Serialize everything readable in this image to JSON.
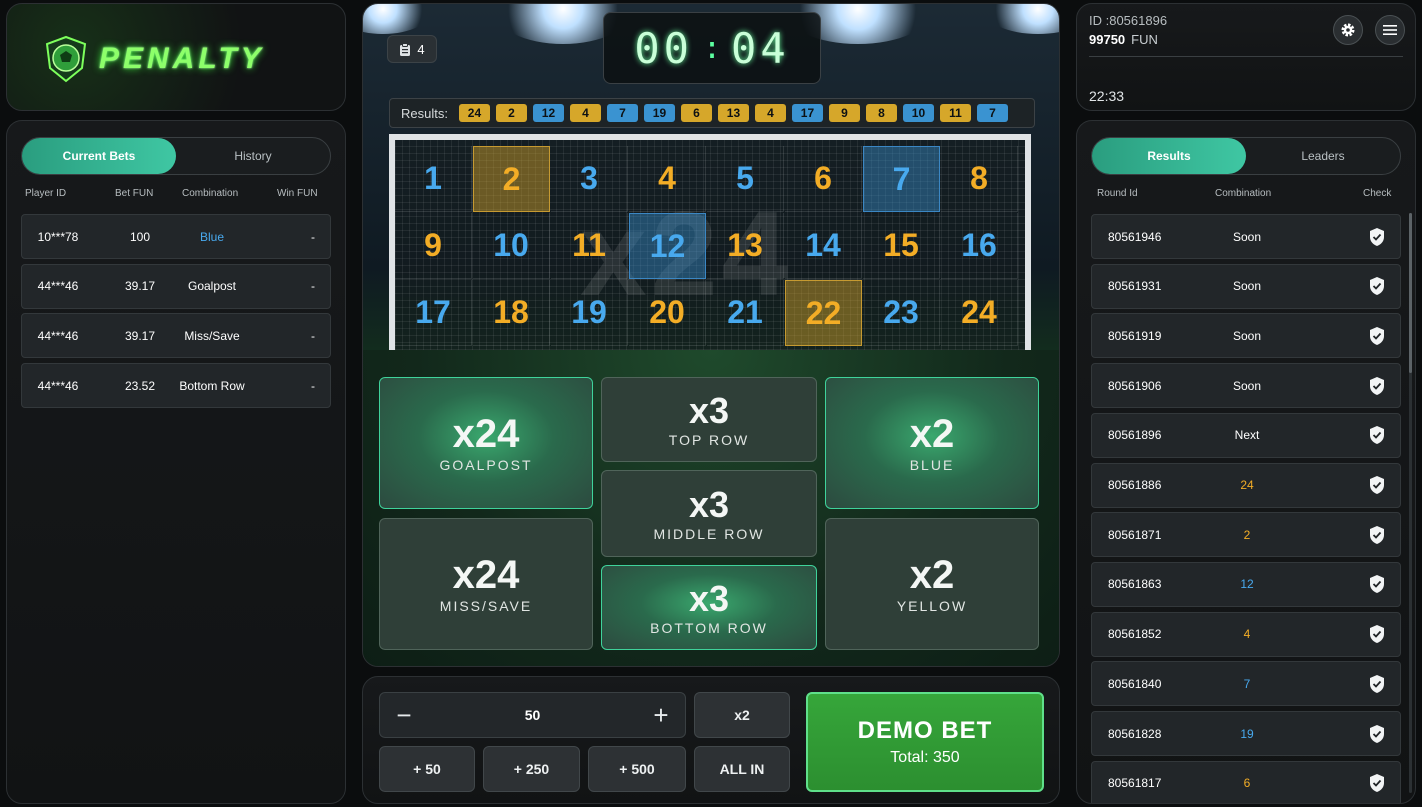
{
  "logo": {
    "text": "PENALTY"
  },
  "bets": {
    "tabs": [
      {
        "label": "Current Bets",
        "active": true
      },
      {
        "label": "History",
        "active": false
      }
    ],
    "headers": {
      "player": "Player ID",
      "bet": "Bet FUN",
      "combination": "Combination",
      "win": "Win FUN"
    },
    "rows": [
      {
        "player": "10***78",
        "bet": "100",
        "combination": "Blue",
        "win": "-",
        "comb_color": "#48a9ee"
      },
      {
        "player": "44***46",
        "bet": "39.17",
        "combination": "Goalpost",
        "win": "-",
        "comb_color": "#ffffff"
      },
      {
        "player": "44***46",
        "bet": "39.17",
        "combination": "Miss/Save",
        "win": "-",
        "comb_color": "#ffffff"
      },
      {
        "player": "44***46",
        "bet": "23.52",
        "combination": "Bottom Row",
        "win": "-",
        "comb_color": "#ffffff"
      }
    ]
  },
  "game": {
    "round_badge": "4",
    "round_badge_icon": "clipboard-icon",
    "timer": {
      "minutes": "00",
      "seconds": "04"
    },
    "results_label": "Results:",
    "results": [
      {
        "n": "24",
        "color": "yellow"
      },
      {
        "n": "2",
        "color": "yellow"
      },
      {
        "n": "12",
        "color": "blue"
      },
      {
        "n": "4",
        "color": "yellow"
      },
      {
        "n": "7",
        "color": "blue"
      },
      {
        "n": "19",
        "color": "blue"
      },
      {
        "n": "6",
        "color": "yellow"
      },
      {
        "n": "13",
        "color": "yellow"
      },
      {
        "n": "4",
        "color": "yellow"
      },
      {
        "n": "17",
        "color": "blue"
      },
      {
        "n": "9",
        "color": "yellow"
      },
      {
        "n": "8",
        "color": "yellow"
      },
      {
        "n": "10",
        "color": "blue"
      },
      {
        "n": "11",
        "color": "yellow"
      },
      {
        "n": "7",
        "color": "blue"
      }
    ],
    "goal_watermark": "x24",
    "grid": [
      {
        "n": "1",
        "c": "b"
      },
      {
        "n": "2",
        "c": "y",
        "hl": "y"
      },
      {
        "n": "3",
        "c": "b"
      },
      {
        "n": "4",
        "c": "y"
      },
      {
        "n": "5",
        "c": "b"
      },
      {
        "n": "6",
        "c": "y"
      },
      {
        "n": "7",
        "c": "b",
        "hl": "b"
      },
      {
        "n": "8",
        "c": "y"
      },
      {
        "n": "9",
        "c": "y"
      },
      {
        "n": "10",
        "c": "b"
      },
      {
        "n": "11",
        "c": "y"
      },
      {
        "n": "12",
        "c": "b",
        "hl": "b"
      },
      {
        "n": "13",
        "c": "y"
      },
      {
        "n": "14",
        "c": "b"
      },
      {
        "n": "15",
        "c": "y"
      },
      {
        "n": "16",
        "c": "b"
      },
      {
        "n": "17",
        "c": "b"
      },
      {
        "n": "18",
        "c": "y"
      },
      {
        "n": "19",
        "c": "b"
      },
      {
        "n": "20",
        "c": "y"
      },
      {
        "n": "21",
        "c": "b"
      },
      {
        "n": "22",
        "c": "y",
        "hl": "y"
      },
      {
        "n": "23",
        "c": "b"
      },
      {
        "n": "24",
        "c": "y"
      }
    ],
    "options": {
      "goalpost": {
        "mult": "x24",
        "name": "GOALPOST"
      },
      "top_row": {
        "mult": "x3",
        "name": "TOP ROW"
      },
      "blue": {
        "mult": "x2",
        "name": "BLUE"
      },
      "middle_row": {
        "mult": "x3",
        "name": "MIDDLE ROW"
      },
      "miss_save": {
        "mult": "x24",
        "name": "MISS/SAVE"
      },
      "bottom_row": {
        "mult": "x3",
        "name": "BOTTOM ROW"
      },
      "yellow": {
        "mult": "x2",
        "name": "YELLOW"
      }
    }
  },
  "controls": {
    "amount": "50",
    "minus": "−",
    "plus": "+",
    "double": "x2",
    "quick": [
      "+ 50",
      "+ 250",
      "+ 500"
    ],
    "all_in": "ALL IN",
    "demo_bet": "DEMO BET",
    "total": "Total: 350"
  },
  "account": {
    "id": "ID :80561896",
    "balance": "99750",
    "currency": "FUN",
    "time": "22:33"
  },
  "results_panel": {
    "tabs": [
      {
        "label": "Results",
        "active": true
      },
      {
        "label": "Leaders",
        "active": false
      }
    ],
    "headers": {
      "round": "Round Id",
      "combination": "Combination",
      "check": "Check"
    },
    "rows": [
      {
        "id": "80561946",
        "comb": "Soon",
        "color": "#ffffff"
      },
      {
        "id": "80561931",
        "comb": "Soon",
        "color": "#ffffff"
      },
      {
        "id": "80561919",
        "comb": "Soon",
        "color": "#ffffff"
      },
      {
        "id": "80561906",
        "comb": "Soon",
        "color": "#ffffff"
      },
      {
        "id": "80561896",
        "comb": "Next",
        "color": "#ffffff"
      },
      {
        "id": "80561886",
        "comb": "24",
        "color": "#f3ad26"
      },
      {
        "id": "80561871",
        "comb": "2",
        "color": "#f3ad26"
      },
      {
        "id": "80561863",
        "comb": "12",
        "color": "#48a9ee"
      },
      {
        "id": "80561852",
        "comb": "4",
        "color": "#f3ad26"
      },
      {
        "id": "80561840",
        "comb": "7",
        "color": "#48a9ee"
      },
      {
        "id": "80561828",
        "comb": "19",
        "color": "#48a9ee"
      },
      {
        "id": "80561817",
        "comb": "6",
        "color": "#f3ad26"
      }
    ]
  }
}
